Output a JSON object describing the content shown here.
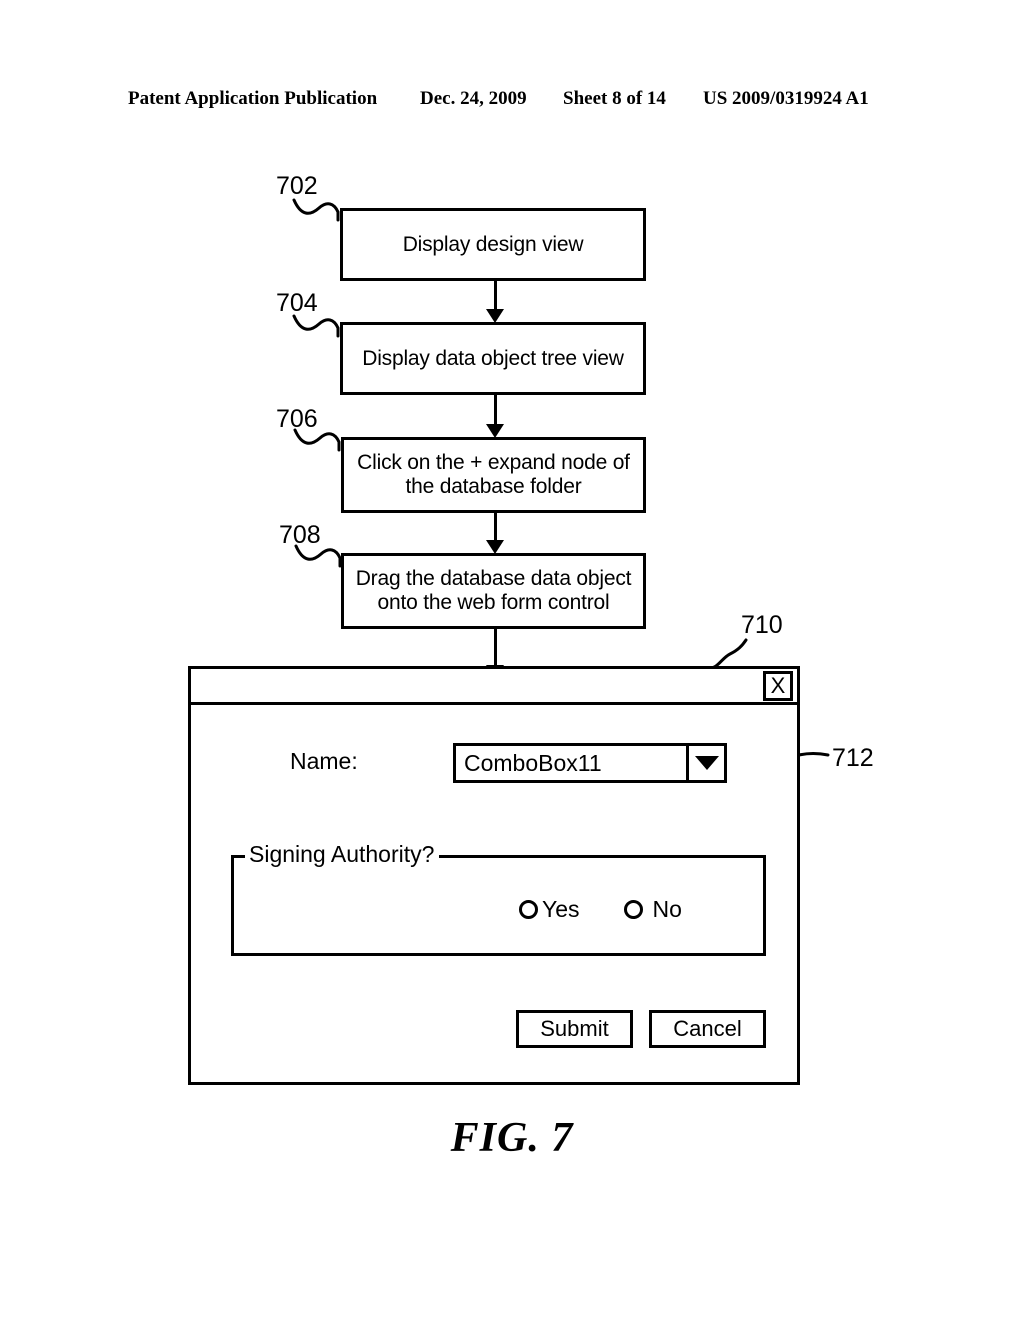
{
  "header": {
    "publication": "Patent Application Publication",
    "date": "Dec. 24, 2009",
    "sheet": "Sheet 8 of 14",
    "document_number": "US 2009/0319924 A1"
  },
  "figure": {
    "caption": "FIG. 7"
  },
  "flowchart": {
    "steps": [
      {
        "ref": "702",
        "line1": "Display design view",
        "line2": ""
      },
      {
        "ref": "704",
        "line1": "Display data object tree view",
        "line2": ""
      },
      {
        "ref": "706",
        "line1": "Click on the + expand node of",
        "line2": "the database folder"
      },
      {
        "ref": "708",
        "line1": "Drag the database data object",
        "line2": "onto the web form control"
      }
    ]
  },
  "dialog": {
    "ref": "710",
    "title": "",
    "close_label": "X",
    "name_field": {
      "label": "Name:",
      "ref": "712",
      "value": "ComboBox11",
      "arrow_icon": "triangle-down-icon"
    },
    "fieldset": {
      "legend": "Signing Authority?",
      "options": [
        {
          "label": "Yes",
          "selected": false
        },
        {
          "label": "No",
          "selected": false
        }
      ]
    },
    "buttons": {
      "submit": "Submit",
      "cancel": "Cancel"
    }
  },
  "colors": {
    "ink": "#000000",
    "paper": "#ffffff"
  }
}
